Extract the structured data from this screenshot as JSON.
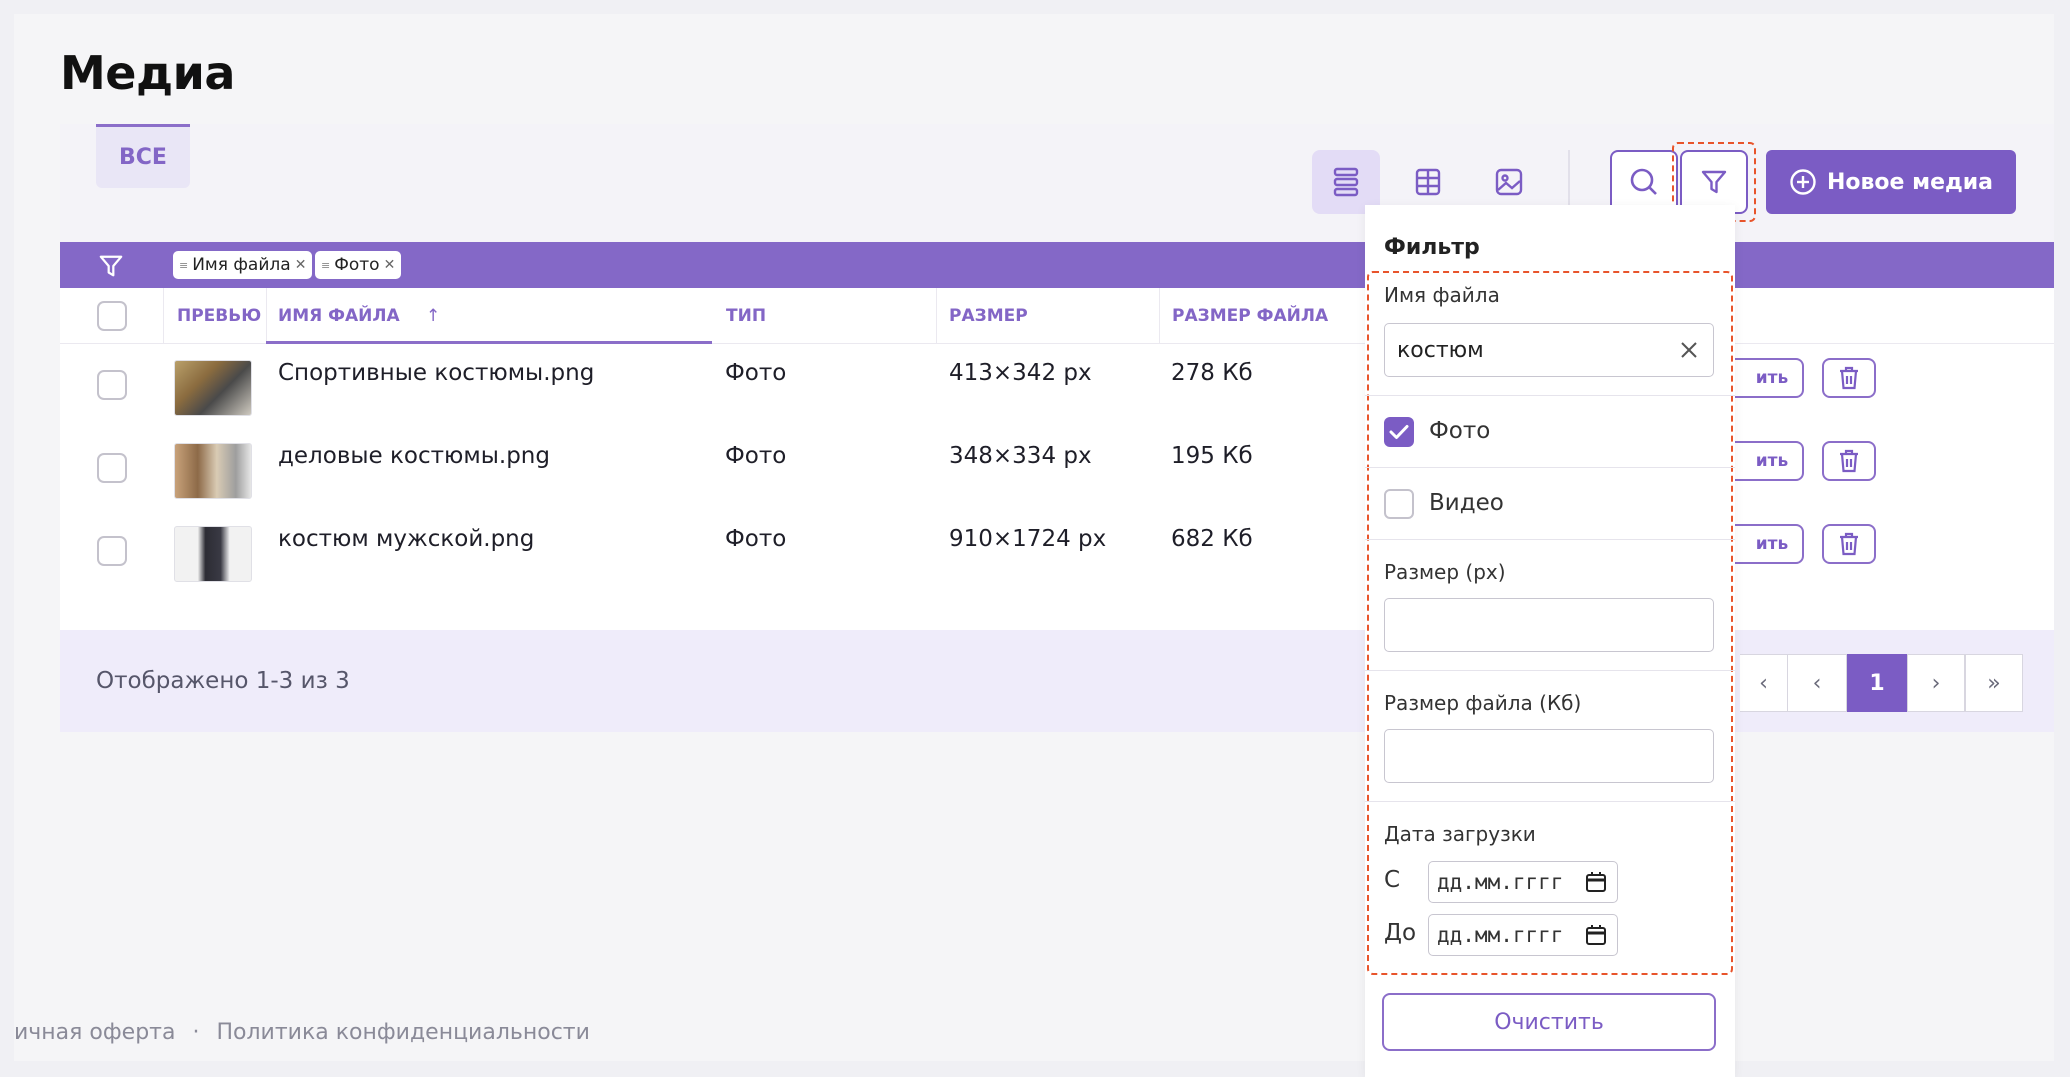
{
  "page": {
    "title": "Медиа"
  },
  "tabs": [
    {
      "label": "ВСЕ"
    }
  ],
  "toolbar": {
    "new_media_label": "Новое медиа"
  },
  "active_filters": [
    {
      "label": "Имя файла"
    },
    {
      "label": "Фото"
    }
  ],
  "table": {
    "columns": {
      "preview": "ПРЕВЬЮ",
      "name": "ИМЯ ФАЙЛА",
      "sort_arrow": "↑",
      "type": "ТИП",
      "size": "РАЗМЕР",
      "file_size": "РАЗМЕР ФАЙЛА"
    },
    "rows": [
      {
        "name": "Спортивные костюмы.png",
        "type": "Фото",
        "size": "413×342 px",
        "file_size": "278 Кб",
        "edit_partial": "ить"
      },
      {
        "name": "деловые костюмы.png",
        "type": "Фото",
        "size": "348×334 px",
        "file_size": "195 Кб",
        "edit_partial": "ить"
      },
      {
        "name": "костюм мужской.png",
        "type": "Фото",
        "size": "910×1724 px",
        "file_size": "682 Кб",
        "edit_partial": "ить"
      }
    ]
  },
  "pagination": {
    "shown_text": "Отображено 1-3 из 3",
    "current_page": "1",
    "prev": "‹",
    "next": "›",
    "last": "»",
    "first_partial": "‹"
  },
  "footer": {
    "left_partial": "ичная оферта",
    "separator": "·",
    "privacy": "Политика конфиденциальности"
  },
  "filter_panel": {
    "title": "Фильтр",
    "name_label": "Имя файла",
    "name_value": "костюм",
    "photo_label": "Фото",
    "photo_checked": true,
    "video_label": "Видео",
    "video_checked": false,
    "size_label": "Размер (px)",
    "file_size_label": "Размер файла (Кб)",
    "date_label": "Дата загрузки",
    "from_label": "С",
    "to_label": "До",
    "date_placeholder": "дд.мм.гггг",
    "clear_label": "Очистить"
  },
  "colors": {
    "accent": "#7b5cc4",
    "filter_bar": "#8468c7",
    "highlight": "#e8542b"
  }
}
